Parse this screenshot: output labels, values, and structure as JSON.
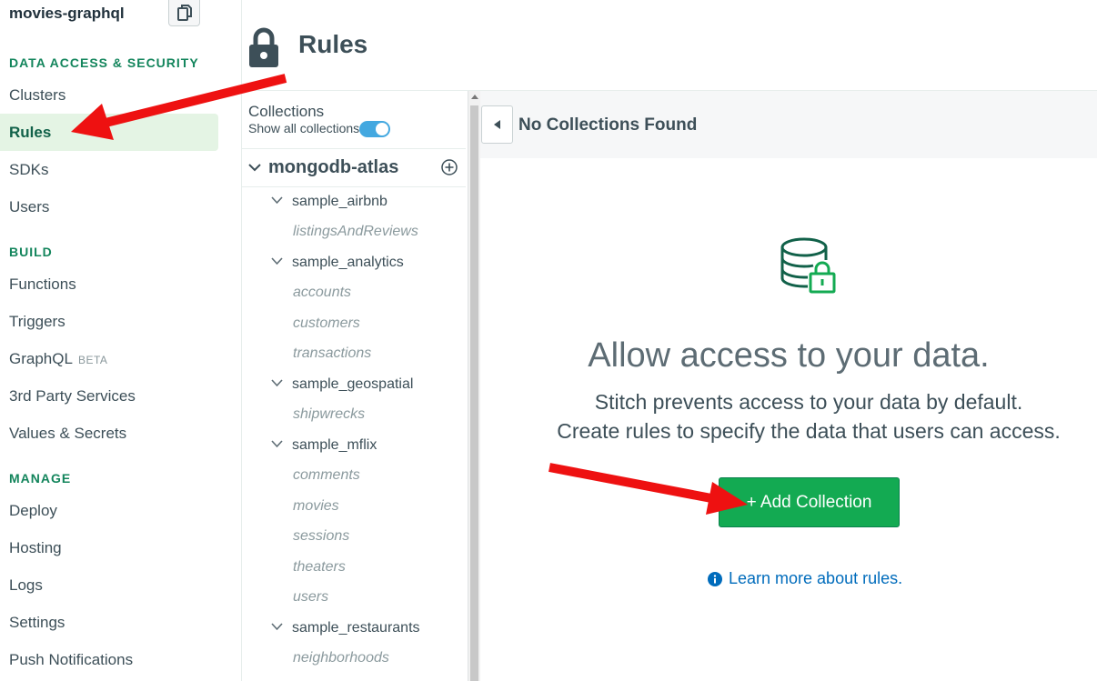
{
  "app": {
    "name": "movies-graphql"
  },
  "sidebar": {
    "sections": [
      {
        "title": "DATA ACCESS & SECURITY",
        "items": [
          "Clusters",
          "Rules",
          "SDKs",
          "Users"
        ]
      },
      {
        "title": "BUILD",
        "items": [
          "Functions",
          "Triggers",
          "GraphQL",
          "3rd Party Services",
          "Values & Secrets"
        ]
      },
      {
        "title": "MANAGE",
        "items": [
          "Deploy",
          "Hosting",
          "Logs",
          "Settings",
          "Push Notifications"
        ]
      }
    ],
    "active_item": "Rules",
    "beta_label": "BETA"
  },
  "header": {
    "title": "Rules"
  },
  "collections_panel": {
    "heading": "Collections",
    "show_all_label": "Show all collections",
    "show_all_enabled": true,
    "cluster": "mongodb-atlas",
    "databases": [
      {
        "name": "sample_airbnb",
        "collections": [
          "listingsAndReviews"
        ]
      },
      {
        "name": "sample_analytics",
        "collections": [
          "accounts",
          "customers",
          "transactions"
        ]
      },
      {
        "name": "sample_geospatial",
        "collections": [
          "shipwrecks"
        ]
      },
      {
        "name": "sample_mflix",
        "collections": [
          "comments",
          "movies",
          "sessions",
          "theaters",
          "users"
        ]
      },
      {
        "name": "sample_restaurants",
        "collections": [
          "neighborhoods"
        ]
      }
    ]
  },
  "main": {
    "status": "No Collections Found",
    "empty_title": "Allow access to your data.",
    "empty_line1": "Stitch prevents access to your data by default.",
    "empty_line2": "Create rules to specify the data that users can access.",
    "add_button": "+ Add Collection",
    "learn_more": "Learn more about rules."
  },
  "colors": {
    "accent_green": "#13aa52",
    "section_green": "#13855c",
    "link_blue": "#006cbc",
    "annotation_red": "#ee1111"
  }
}
